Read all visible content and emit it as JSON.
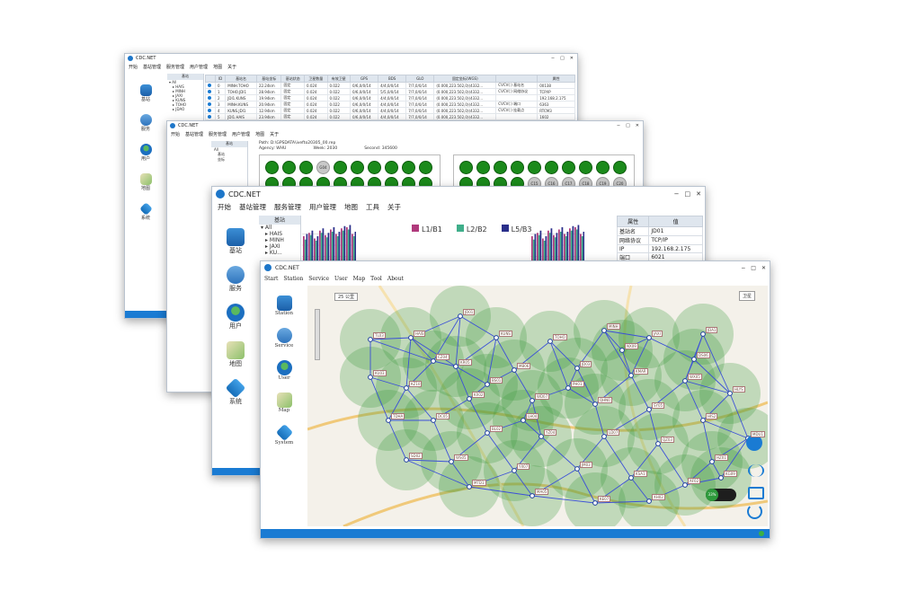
{
  "app": {
    "name": "CDC.NET"
  },
  "colors": {
    "accent": "#1a7bd3",
    "coverage": "#3c9a3c",
    "satellite": "#1b8a1b",
    "link": "#3b4fd8"
  },
  "icons": {
    "station": "radio-tower-icon",
    "service": "broadcast-icon",
    "user": "users-globe-icon",
    "map": "map-pin-icon",
    "system": "cube-icon"
  },
  "w1": {
    "menu": [
      "开始",
      "基站管理",
      "服务管理",
      "用户管理",
      "地图",
      "关于"
    ],
    "nav": [
      "基站",
      "服务",
      "用户",
      "地图",
      "系统"
    ],
    "tree_header": "基站",
    "tree_root": "All",
    "tree_items": [
      "HAIS",
      "MINH",
      "JAXI",
      "KUNS",
      "TOHO",
      "JDAO"
    ],
    "columns": [
      "ID",
      "基站名",
      "基站坐标",
      "基站状态",
      "卫星数量",
      "有效卫星",
      "GPS",
      "BDS",
      "GLO",
      "固定坐标(WGS)",
      "",
      "属性"
    ],
    "rows": [
      [
        "0",
        "MINH.TOHO",
        "22.24km",
        "固定",
        "0.024",
        "0.022",
        "0/6,0/0/14",
        "4/4,0/0/14",
        "7/7,0/0/14",
        "(0.000,223.502,0)(4332...",
        "CVCV(:) 基站名",
        "00138"
      ],
      [
        "1",
        "TOHO.JDI1",
        "28.94km",
        "固定",
        "0.024",
        "0.022",
        "0/6,0/0/14",
        "5/5,0/0/14",
        "7/7,0/0/14",
        "(0.000,223.502,0)(4332...",
        "CVCV(:) 网络协议",
        "TCP/IP"
      ],
      [
        "2",
        "JDI1.KUNS",
        "19.94km",
        "固定",
        "0.024",
        "0.022",
        "0/6,0/0/14",
        "4/4,0/0/14",
        "7/7,0/0/14",
        "(0.000,223.502,0)(4332...",
        "",
        "192.168.2.175"
      ],
      [
        "3",
        "MINH.KUNS",
        "20.94km",
        "固定",
        "0.024",
        "0.022",
        "0/6,0/0/14",
        "4/4,0/0/14",
        "7/7,0/0/14",
        "(0.000,223.502,0)(4332...",
        "CVCV(:) 端口",
        "6363"
      ],
      [
        "4",
        "KUNS.JDI1",
        "12.94km",
        "固定",
        "0.024",
        "0.022",
        "0/6,0/0/14",
        "4/4,0/0/14",
        "7/7,0/0/14",
        "(0.000,223.502,0)(4332...",
        "CVCV(:) 挂载点",
        "RTCM3"
      ],
      [
        "5",
        "JDI1.HAIS",
        "23.94km",
        "固定",
        "0.024",
        "0.022",
        "0/6,0/0/14",
        "4/4,0/0/14",
        "7/7,0/0/14",
        "(0.000,223.502,0)(4332...",
        "",
        "1602"
      ]
    ]
  },
  "w2": {
    "menu": [
      "开始",
      "基站管理",
      "服务管理",
      "用户管理",
      "地图",
      "关于"
    ],
    "tree_header": "基站",
    "tree_items": [
      "All",
      "基站",
      "坐标"
    ],
    "path": "Path: D:\\GPSDATA\\ivefto20305_00.rep",
    "agency": "Agency: WHU",
    "week": "Week: 2030",
    "second": "Second: 345600",
    "sat_left_gray": [
      "G04"
    ],
    "sat_right_gray": [
      "C15",
      "C16",
      "C17",
      "C18",
      "C19",
      "C20"
    ]
  },
  "w3": {
    "menu": [
      "开始",
      "基站管理",
      "服务管理",
      "用户管理",
      "地图",
      "工具",
      "关于"
    ],
    "nav": [
      "基站",
      "服务",
      "用户",
      "地图",
      "系统"
    ],
    "tree_header": "基站",
    "tree_root": "All",
    "tree_items": [
      "HAIS",
      "MINH",
      "JAXI",
      "KU..."
    ],
    "legend": [
      "L1/B1",
      "L2/B2",
      "L5/B3"
    ],
    "legend_colors": [
      "#b03a7c",
      "#3fae8a",
      "#2a2f8a"
    ],
    "kv_header": [
      "属性",
      "值"
    ],
    "kv": [
      [
        "基站名",
        "JD01"
      ],
      [
        "网络协议",
        "TCP/IP"
      ],
      [
        "IP",
        "192.168.2.175"
      ],
      [
        "端口",
        "6021"
      ]
    ],
    "chart_data": {
      "type": "bar",
      "series": [
        {
          "name": "L1/B1",
          "values": [
            28,
            31,
            26,
            33,
            29,
            34,
            30,
            35,
            36,
            30
          ]
        },
        {
          "name": "L2/B2",
          "values": [
            25,
            29,
            24,
            31,
            27,
            32,
            28,
            33,
            34,
            28
          ]
        },
        {
          "name": "L5/B3",
          "values": [
            30,
            33,
            28,
            35,
            31,
            36,
            32,
            37,
            38,
            32
          ]
        }
      ],
      "ylim": [
        0,
        40
      ],
      "grid": true
    }
  },
  "w4": {
    "menu": [
      "Start",
      "Station",
      "Service",
      "User",
      "Map",
      "Tool",
      "About"
    ],
    "nav": [
      "Station",
      "Service",
      "User",
      "Map",
      "System"
    ],
    "scale": "25 公里",
    "map_type": "卫星",
    "percent": "33%",
    "stations": [
      "JD01",
      "HAIS",
      "KUNS",
      "TOHO",
      "MINH",
      "JAXI",
      "JDA1",
      "KR05",
      "MB06",
      "JD03",
      "KMAR",
      "WX05",
      "HLYS",
      "KU03",
      "KZ10",
      "KX02",
      "WD07",
      "QHN0",
      "SY05",
      "HIS2",
      "MDU1",
      "TDHA",
      "DC05",
      "BL02",
      "YZ04",
      "LD07",
      "QZ03",
      "HZ01",
      "SD02",
      "WS05",
      "YX07",
      "JM03",
      "KSA1",
      "AF02",
      "KG09",
      "MTD1",
      "MA05",
      "KE07",
      "XH02",
      "TL03",
      "DS06",
      "PH01",
      "CZ04",
      "NX09",
      "BS01",
      "LH04"
    ]
  }
}
